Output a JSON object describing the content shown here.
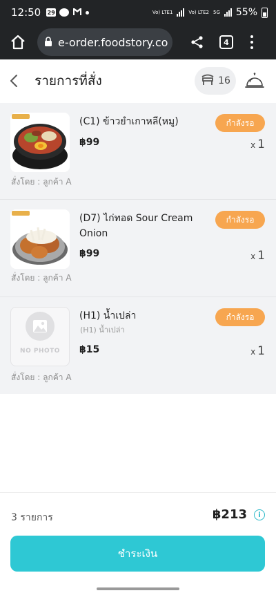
{
  "status_bar": {
    "time": "12:50",
    "notification_badge": "29",
    "battery_percent": "55%",
    "sim1": "Vo) LTE1",
    "sim2": "Vo) LTE2",
    "network": "5G"
  },
  "browser": {
    "url": "e-order.foodstory.co",
    "tab_count": "4"
  },
  "header": {
    "title": "รายการที่สั่ง",
    "table_number": "16"
  },
  "items": [
    {
      "name": "(C1) ข้าวยำเกาหลี(หมู)",
      "subtitle": "",
      "price": "฿99",
      "status": "กำลังรอ",
      "qty_prefix": "x",
      "qty": "1",
      "ordered_by": "สั่งโดย : ลูกค้า A",
      "image": "bibimbap-photo"
    },
    {
      "name": "(D7) ไก่ทอด Sour Cream Onion",
      "subtitle": "",
      "price": "฿99",
      "status": "กำลังรอ",
      "qty_prefix": "x",
      "qty": "1",
      "ordered_by": "สั่งโดย : ลูกค้า A",
      "image": "fried-chicken-photo"
    },
    {
      "name": "(H1) น้ำเปล่า",
      "subtitle": "(H1) น้ำเปล่า",
      "price": "฿15",
      "status": "กำลังรอ",
      "qty_prefix": "x",
      "qty": "1",
      "ordered_by": "สั่งโดย : ลูกค้า A",
      "image": "no-photo",
      "no_photo_label": "NO PHOTO"
    }
  ],
  "footer": {
    "item_count": "3 รายการ",
    "total": "฿213",
    "pay_label": "ชำระเงิน"
  },
  "colors": {
    "accent": "#2ec8d4",
    "status_badge": "#f7a650",
    "list_background": "#f2f3f5",
    "browser_chrome": "#222426"
  }
}
